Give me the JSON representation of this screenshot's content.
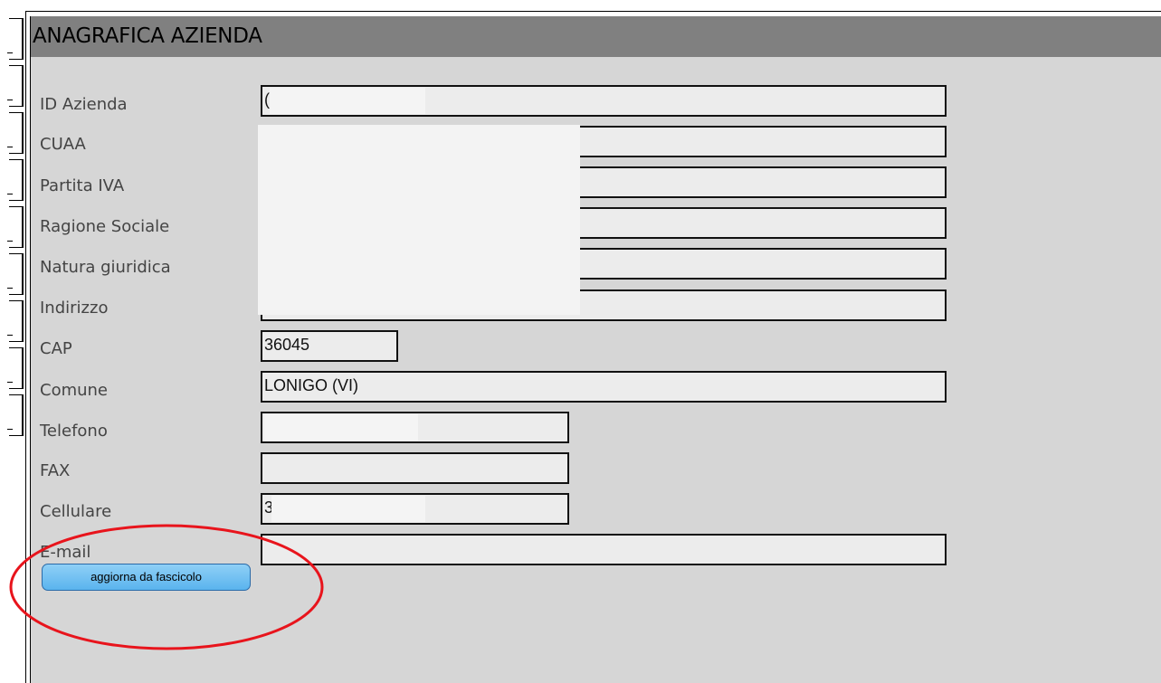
{
  "panel": {
    "title": "ANAGRAFICA AZIENDA"
  },
  "fields": [
    {
      "key": "id_azienda",
      "label": "ID Azienda",
      "value": "(",
      "redacted": true
    },
    {
      "key": "cuaa",
      "label": "CUAA",
      "value": "",
      "redacted": true
    },
    {
      "key": "partita_iva",
      "label": "Partita IVA",
      "value": "",
      "redacted": true
    },
    {
      "key": "ragione_sociale",
      "label": "Ragione Sociale",
      "value": "",
      "redacted": true
    },
    {
      "key": "natura_giuridica",
      "label": "Natura giuridica",
      "value": "",
      "redacted": true
    },
    {
      "key": "indirizzo",
      "label": "Indirizzo",
      "value": "",
      "redacted": true
    },
    {
      "key": "cap",
      "label": "CAP",
      "value": "36045"
    },
    {
      "key": "comune",
      "label": "Comune",
      "value": "LONIGO (VI)"
    },
    {
      "key": "telefono",
      "label": "Telefono",
      "value": "",
      "redacted": true
    },
    {
      "key": "fax",
      "label": "FAX",
      "value": ""
    },
    {
      "key": "cellulare",
      "label": "Cellulare",
      "value": "3",
      "redacted": true
    },
    {
      "key": "email",
      "label": "E-mail",
      "value": ""
    }
  ],
  "actions": {
    "update_button_label": "aggiorna da fascicolo"
  },
  "colors": {
    "panel_background": "#d6d6d6",
    "header_background": "#808080",
    "button_blue": "#5ab4ee",
    "annotation_red": "#e8141c"
  },
  "annotation": {
    "type": "red-ellipse",
    "target": "update-from-file-button"
  }
}
